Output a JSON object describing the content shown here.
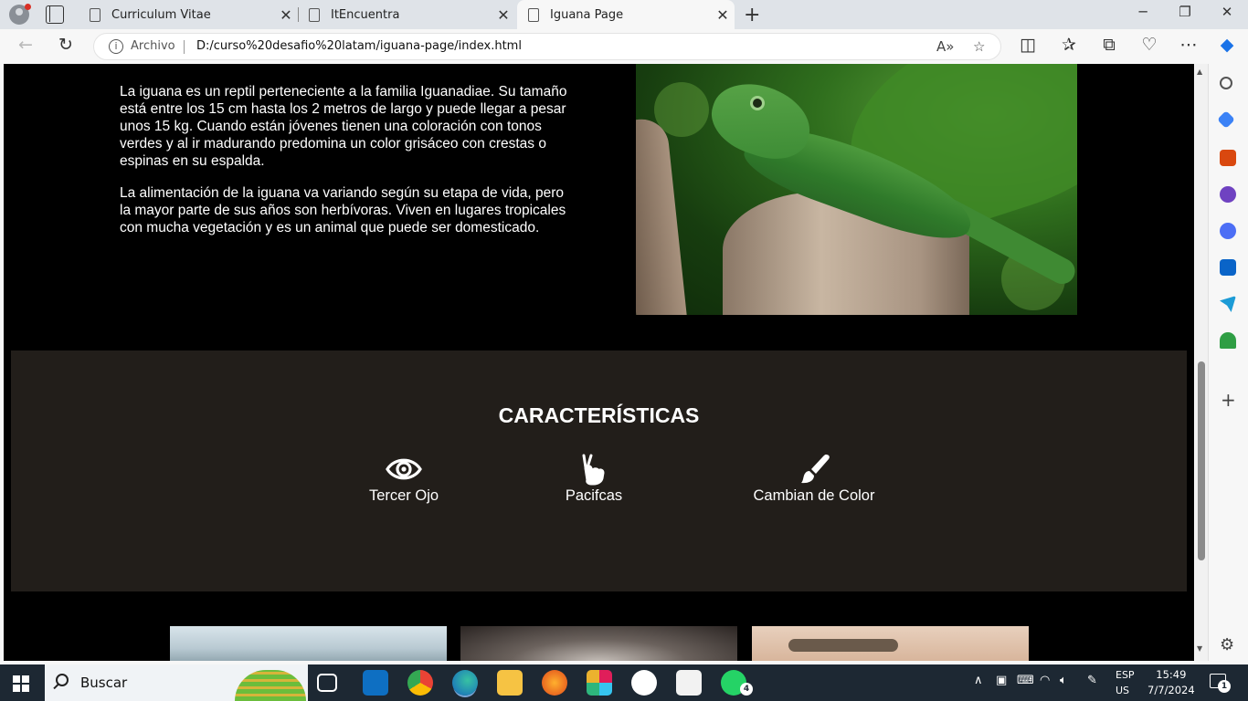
{
  "browser": {
    "tabs": [
      {
        "title": "Curriculum Vitae"
      },
      {
        "title": "ItEncuentra"
      },
      {
        "title": "Iguana Page"
      }
    ],
    "address": {
      "scheme_label": "Archivo",
      "url": "D:/curso%20desafio%20latam/iguana-page/index.html"
    }
  },
  "page": {
    "intro": {
      "p1": "La iguana es un reptil perteneciente a la familia Iguanadiae. Su tamaño está entre los 15 cm hasta los 2 metros de largo y puede llegar a pesar unos 15 kg. Cuando están jóvenes tienen una coloración con tonos verdes y al ir madurando predomina un color grisáceo con crestas o espinas en su espalda.",
      "p2": "La alimentación de la iguana va variando según su etapa de vida, pero la mayor parte de sus años son herbívoras. Viven en lugares tropicales con mucha vegetación y es un animal que puede ser domesticado."
    },
    "features": {
      "title": "CARACTERÍSTICAS",
      "items": [
        {
          "label": "Tercer Ojo",
          "icon": "eye-icon"
        },
        {
          "label": "Pacifcas",
          "icon": "peace-hand-icon"
        },
        {
          "label": "Cambian de Color",
          "icon": "paintbrush-icon"
        }
      ]
    },
    "colors": {
      "page_bg": "#000000",
      "features_bg": "#221e1a",
      "text": "#ffffff"
    }
  },
  "taskbar": {
    "search_label": "Buscar",
    "lang": "ESP",
    "region": "US",
    "time": "15:49",
    "date": "7/7/2024",
    "whatsapp_badge": "4",
    "notification_badge": "1"
  }
}
